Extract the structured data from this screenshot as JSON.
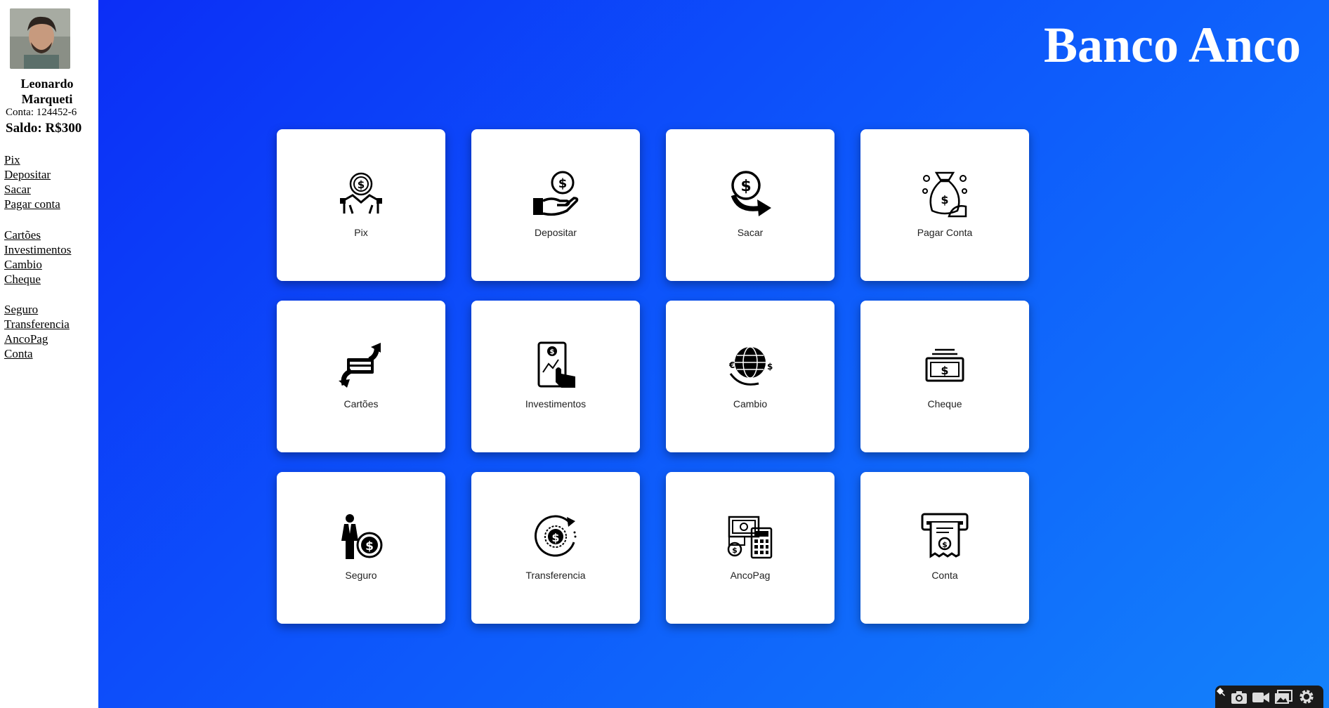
{
  "user": {
    "name": "Leonardo Marqueti",
    "account": "Conta: 124452-6",
    "balance": "Saldo: R$300"
  },
  "sidebar": {
    "groups": [
      [
        "Pix",
        "Depositar",
        "Sacar",
        "Pagar conta"
      ],
      [
        "Cartões",
        "Investimentos",
        "Cambio",
        "Cheque"
      ],
      [
        "Seguro",
        "Transferencia",
        "AncoPag",
        "Conta"
      ]
    ]
  },
  "header": {
    "title": "Banco Anco"
  },
  "cards": [
    {
      "label": "Pix",
      "icon": "pix-coin-icon"
    },
    {
      "label": "Depositar",
      "icon": "hand-coin-icon"
    },
    {
      "label": "Sacar",
      "icon": "coin-arrow-icon"
    },
    {
      "label": "Pagar Conta",
      "icon": "money-bag-icon"
    },
    {
      "label": "Cartões",
      "icon": "card-exchange-icon"
    },
    {
      "label": "Investimentos",
      "icon": "tablet-touch-icon"
    },
    {
      "label": "Cambio",
      "icon": "globe-currency-icon"
    },
    {
      "label": "Cheque",
      "icon": "banknote-stack-icon"
    },
    {
      "label": "Seguro",
      "icon": "businessman-coin-icon"
    },
    {
      "label": "Transferencia",
      "icon": "circular-coin-icon"
    },
    {
      "label": "AncoPag",
      "icon": "cash-calculator-icon"
    },
    {
      "label": "Conta",
      "icon": "receipt-atm-icon"
    }
  ],
  "colors": {
    "gradient_start": "#0c2ef6",
    "gradient_end": "#1382fb",
    "card_bg": "#ffffff"
  },
  "toolbar": {
    "icons": [
      "pin-icon",
      "camera-icon",
      "video-icon",
      "gallery-icon",
      "gear-icon"
    ]
  }
}
